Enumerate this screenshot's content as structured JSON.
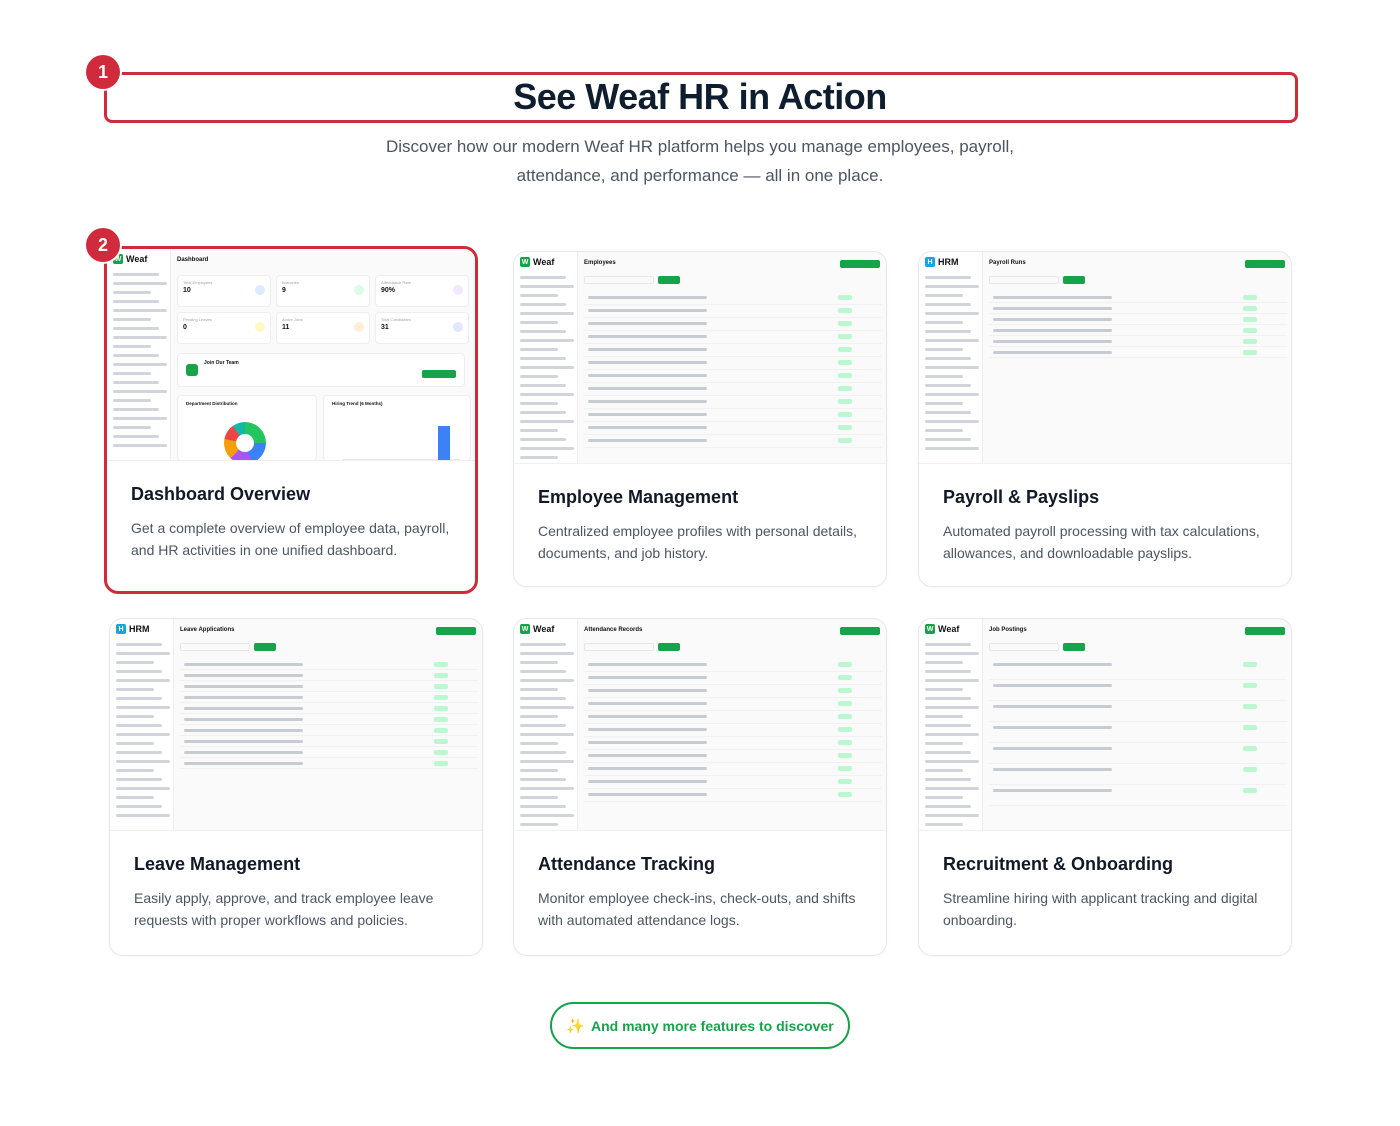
{
  "header": {
    "title": "See Weaf HR in Action",
    "subtitle": "Discover how our modern Weaf HR platform helps you manage employees, payroll, attendance, and performance — all in one place."
  },
  "markers": [
    "1",
    "2"
  ],
  "cards": [
    {
      "title": "Dashboard Overview",
      "description": "Get a complete overview of employee data, payroll, and HR activities in one unified dashboard.",
      "shot": {
        "brand": "Weaf",
        "heading": "Dashboard",
        "stats": [
          {
            "label": "Total Employees",
            "value": "10"
          },
          {
            "label": "Branches",
            "value": "9"
          },
          {
            "label": "Attendance Rate",
            "value": "90%"
          },
          {
            "label": "Pending Leaves",
            "value": "0"
          },
          {
            "label": "Active Jobs",
            "value": "11"
          },
          {
            "label": "Total Candidates",
            "value": "31"
          }
        ],
        "join_title": "Join Our Team",
        "dept_title": "Department Distribution",
        "trend_title": "Hiring Trend (6 Months)"
      }
    },
    {
      "title": "Employee Management",
      "description": "Centralized employee profiles with personal details, documents, and job history.",
      "shot": {
        "brand": "Weaf",
        "heading": "Employees"
      }
    },
    {
      "title": "Payroll & Payslips",
      "description": "Automated payroll processing with tax calculations, allowances, and downloadable payslips.",
      "shot": {
        "brand": "HRM",
        "heading": "Payroll Runs"
      }
    },
    {
      "title": "Leave Management",
      "description": "Easily apply, approve, and track employee leave requests with proper workflows and policies.",
      "shot": {
        "brand": "HRM",
        "heading": "Leave Applications"
      }
    },
    {
      "title": "Attendance Tracking",
      "description": "Monitor employee check-ins, check-outs, and shifts with automated attendance logs.",
      "shot": {
        "brand": "Weaf",
        "heading": "Attendance Records"
      }
    },
    {
      "title": "Recruitment & Onboarding",
      "description": "Streamline hiring with applicant tracking and digital onboarding.",
      "shot": {
        "brand": "Weaf",
        "heading": "Job Postings"
      }
    }
  ],
  "cta": {
    "label": "And many more features to discover",
    "icon": "sparkles-icon"
  },
  "colors": {
    "accent": "#16a34a",
    "highlight": "#d02b3d",
    "title": "#0f1e2e"
  }
}
